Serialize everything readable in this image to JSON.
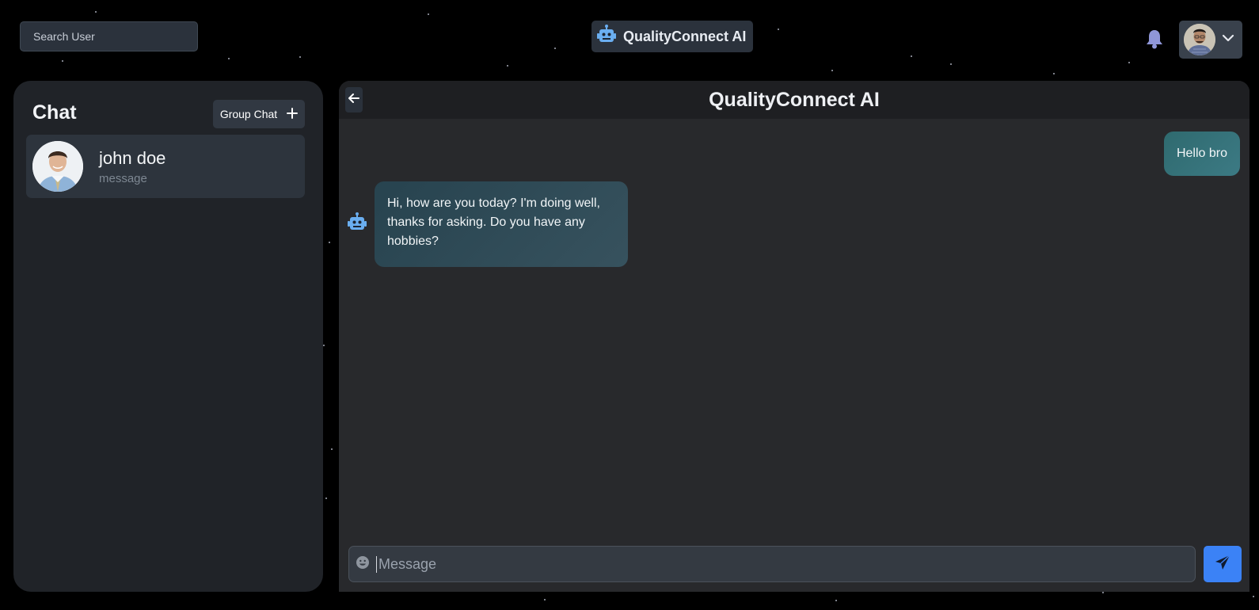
{
  "header": {
    "search_placeholder": "Search User",
    "brand_title": "QualityConnect AI",
    "icons": [
      "robot-icon",
      "bell-icon",
      "chevron-down-icon"
    ]
  },
  "sidebar": {
    "title": "Chat",
    "group_chat_label": "Group Chat",
    "conversations": [
      {
        "name": "john doe",
        "preview": "message"
      }
    ]
  },
  "chat": {
    "title": "QualityConnect AI",
    "messages": [
      {
        "sender": "user",
        "text": "Hello bro"
      },
      {
        "sender": "bot",
        "text": "Hi, how are you today? I'm doing well, thanks for asking. Do you have any hobbies?"
      }
    ],
    "input_placeholder": "Message"
  },
  "colors": {
    "background": "#000000",
    "panel": "#202328",
    "chat_area": "#28292c",
    "accent": "#3b82f6",
    "user_bubble": "#2f6a6f",
    "bot_bubble": "#2e4a56"
  }
}
